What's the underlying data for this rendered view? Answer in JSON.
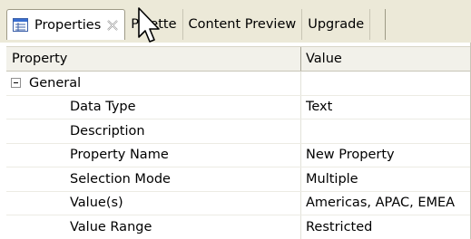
{
  "tabs": [
    {
      "label": "Properties",
      "active": true,
      "icon": "properties-icon"
    },
    {
      "label": "Palette",
      "active": false
    },
    {
      "label": "Content Preview",
      "active": false
    },
    {
      "label": "Upgrade",
      "active": false
    }
  ],
  "table": {
    "headers": {
      "property": "Property",
      "value": "Value"
    },
    "group": {
      "label": "General",
      "expanded": true
    },
    "rows": [
      {
        "property": "Data Type",
        "value": "Text"
      },
      {
        "property": "Description",
        "value": ""
      },
      {
        "property": "Property Name",
        "value": "New Property"
      },
      {
        "property": "Selection Mode",
        "value": "Multiple"
      },
      {
        "property": "Value(s)",
        "value": "Americas, APAC, EMEA"
      },
      {
        "property": "Value Range",
        "value": "Restricted"
      }
    ]
  },
  "colors": {
    "tab_bar_bg": "#ece9d8",
    "header_bg": "#f2f1ea",
    "row_divider": "#ecebe4"
  }
}
